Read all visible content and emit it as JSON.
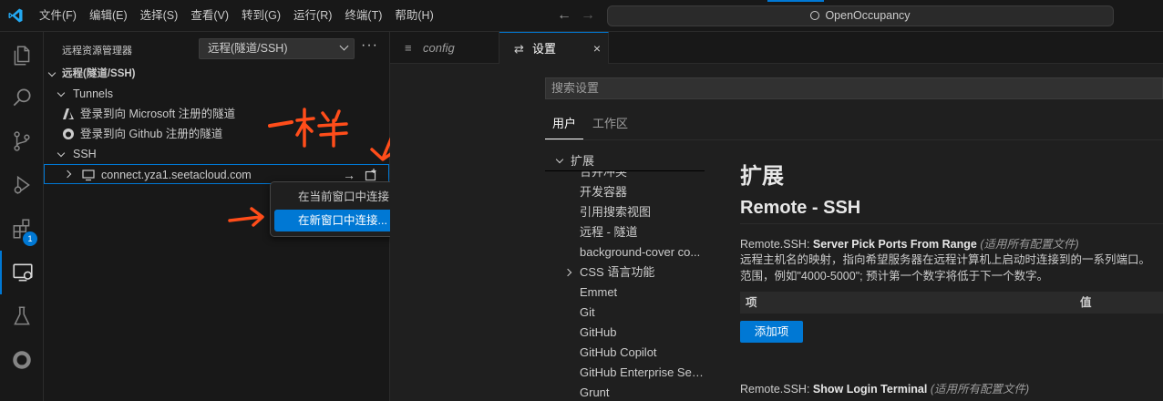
{
  "titlebar": {
    "menu": [
      "文件(F)",
      "编辑(E)",
      "选择(S)",
      "查看(V)",
      "转到(G)",
      "运行(R)",
      "终端(T)",
      "帮助(H)"
    ],
    "search_text": "OpenOccupancy"
  },
  "activitybar": {
    "items": [
      "explorer-icon",
      "search-icon",
      "source-control-icon",
      "run-debug-icon",
      "extensions-icon",
      "remote-explorer-icon",
      "testing-icon",
      "github-icon"
    ],
    "extensions_badge": "1"
  },
  "sidebar": {
    "title": "远程资源管理器",
    "selector_value": "远程(隧道/SSH)",
    "more_label": "···",
    "section_title": "远程(隧道/SSH)",
    "tunnels_label": "Tunnels",
    "tunnel_items": [
      "登录到向 Microsoft 注册的隧道",
      "登录到向 Github 注册的隧道"
    ],
    "ssh_label": "SSH",
    "ssh_host": "connect.yza1.seetacloud.com"
  },
  "context_menu": {
    "items": [
      "在当前窗口中连接...",
      "在新窗口中连接..."
    ],
    "selected_index": 1
  },
  "annotation": {
    "text": "一样",
    "color": "#ff4d1a"
  },
  "tabs": [
    {
      "label": "config",
      "icon": "lines-icon",
      "active": false
    },
    {
      "label": "设置",
      "icon": "settings-icon",
      "active": true,
      "close": "×"
    }
  ],
  "settings": {
    "search_placeholder": "搜索设置",
    "scope_tabs": [
      "用户",
      "工作区"
    ],
    "toc_header": "扩展",
    "toc_items": [
      "合并冲突",
      "开发容器",
      "引用搜索视图",
      "远程 - 隧道",
      "background-cover co...",
      "CSS 语言功能",
      "Emmet",
      "Git",
      "GitHub",
      "GitHub Copilot",
      "GitHub Enterprise Ser...",
      "Grunt"
    ],
    "section_title": "扩展",
    "subsection_title": "Remote - SSH",
    "setting1": {
      "prefix": "Remote.SSH: ",
      "name": "Server Pick Ports From Range",
      "scope": "(适用所有配置文件)",
      "desc_line1": "远程主机名的映射，指向希望服务器在远程计算机上启动时连接到的一系列端口。",
      "desc_line2": "范围，例如\"4000-5000\"; 预计第一个数字将低于下一个数字。",
      "col_key": "项",
      "col_value": "值",
      "add_button": "添加项"
    },
    "setting2": {
      "prefix": "Remote.SSH: ",
      "name": "Show Login Terminal",
      "scope": "(适用所有配置文件)"
    }
  },
  "colors": {
    "accent": "#0078d4",
    "background": "#1f1f1f",
    "sidebar": "#181818"
  }
}
